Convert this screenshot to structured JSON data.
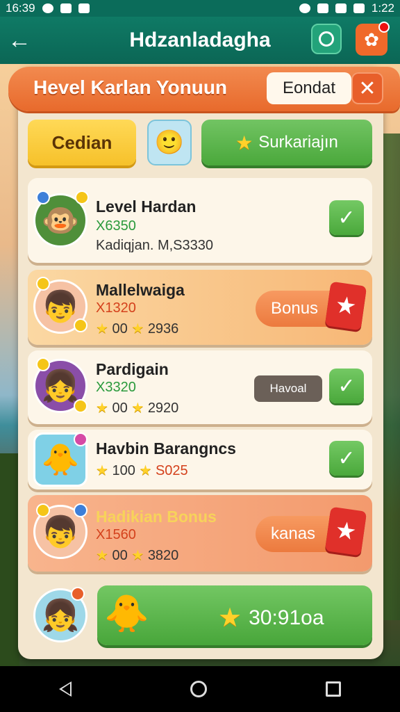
{
  "status_bar": {
    "time": "16:39",
    "clock_right": "1:22"
  },
  "app_bar": {
    "title": "Hdzanladagha"
  },
  "panel": {
    "title": "Hevel Karlan Yonuun",
    "head_button": "Eondat"
  },
  "tabs": {
    "yellow": "Cedian",
    "green": "Surkariajın"
  },
  "rows": [
    {
      "name": "Level Hardan",
      "sub": "X6350",
      "extra": "Kadiqjan. M,S3330"
    },
    {
      "name": "Mallelwaiga",
      "sub": "X1320",
      "stat1": "00",
      "stat2": "2936",
      "action": "Bonus"
    },
    {
      "name": "Pardigain",
      "sub": "X3320",
      "stat1": "00",
      "stat2": "2920",
      "action": "Havoal"
    },
    {
      "name": "Havbin Barangncs",
      "stat1": "100",
      "stat2": "S025"
    },
    {
      "name": "Hadikian Bonus",
      "sub": "X1560",
      "stat1": "00",
      "stat2": "3820",
      "action": "kanas"
    }
  ],
  "bottom_button": {
    "label": "30:91oa"
  },
  "colors": {
    "primary": "#0f7a65",
    "accent": "#e86a2c",
    "green": "#4aa83b",
    "yellow": "#f6c12a"
  }
}
